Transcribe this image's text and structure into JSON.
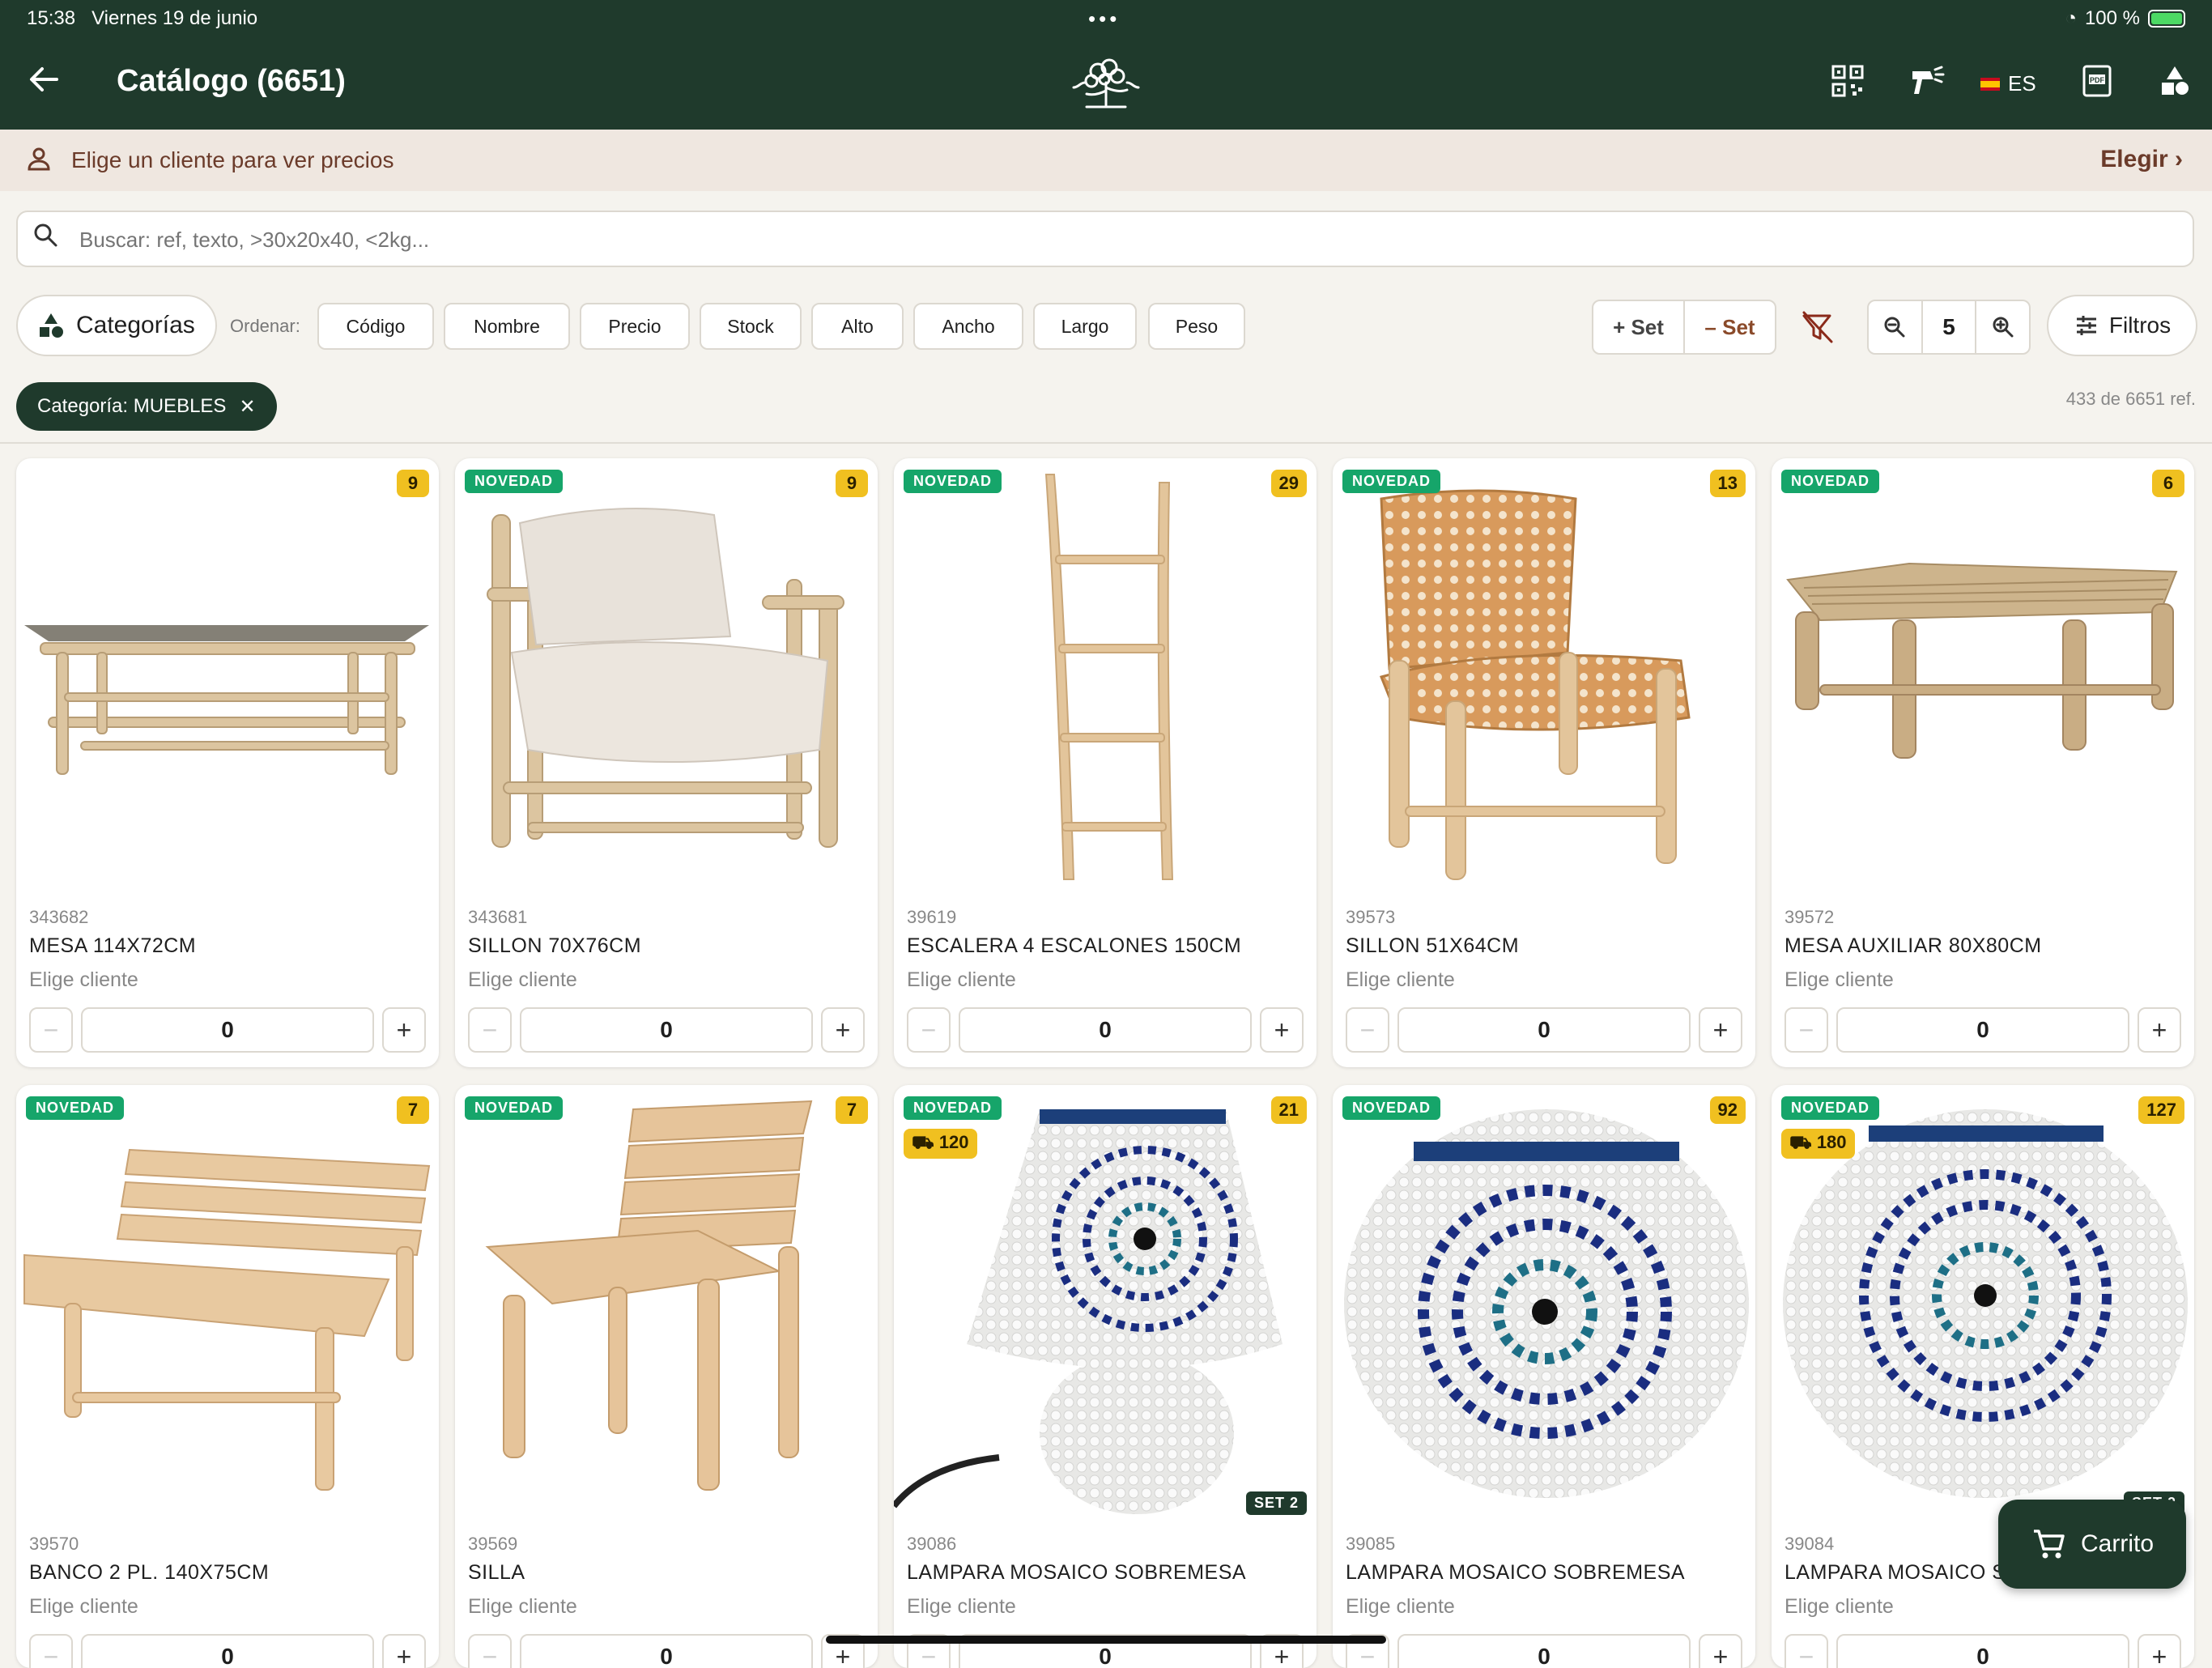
{
  "status": {
    "time": "15:38",
    "date": "Viernes 19 de junio",
    "battery": "100 %",
    "battery_level": 1.0
  },
  "header": {
    "back_icon": "arrow-left-icon",
    "title": "Catálogo (6651)",
    "language": "ES"
  },
  "client_bar": {
    "message": "Elige un cliente para ver precios",
    "action": "Elegir ›"
  },
  "search": {
    "placeholder": "Buscar: ref, texto, >30x20x40, <2kg..."
  },
  "toolbar": {
    "categories_label": "Categorías",
    "sort_label": "Ordenar:",
    "sort_options": [
      "Código",
      "Nombre",
      "Precio",
      "Stock",
      "Alto",
      "Ancho",
      "Largo",
      "Peso"
    ],
    "add_set": "+ Set",
    "remove_set": "– Set",
    "zoom_value": "5",
    "filters_label": "Filtros"
  },
  "filter_chip": {
    "label": "Categoría: MUEBLES",
    "close": "✕"
  },
  "results_count": "433 de 6651 ref.",
  "colors": {
    "brand": "#1f3a2c",
    "accent_new": "#16a56a",
    "stock_badge": "#f0c020",
    "client_text": "#6b3b2a"
  },
  "products": [
    {
      "ref": "343682",
      "name": "MESA 114X72CM",
      "price": "Elige cliente",
      "qty": "0",
      "stock": "9",
      "new": "",
      "truck": "",
      "set": ""
    },
    {
      "ref": "343681",
      "name": "SILLON 70X76CM",
      "price": "Elige cliente",
      "qty": "0",
      "stock": "9",
      "new": "NOVEDAD",
      "truck": "",
      "set": ""
    },
    {
      "ref": "39619",
      "name": "ESCALERA 4 ESCALONES 150CM",
      "price": "Elige cliente",
      "qty": "0",
      "stock": "29",
      "new": "NOVEDAD",
      "truck": "",
      "set": ""
    },
    {
      "ref": "39573",
      "name": "SILLON 51X64CM",
      "price": "Elige cliente",
      "qty": "0",
      "stock": "13",
      "new": "NOVEDAD",
      "truck": "",
      "set": ""
    },
    {
      "ref": "39572",
      "name": "MESA AUXILIAR 80X80CM",
      "price": "Elige cliente",
      "qty": "0",
      "stock": "6",
      "new": "NOVEDAD",
      "truck": "",
      "set": ""
    },
    {
      "ref": "39570",
      "name": "BANCO 2 PL. 140X75CM",
      "price": "Elige cliente",
      "qty": "0",
      "stock": "7",
      "new": "NOVEDAD",
      "truck": "",
      "set": ""
    },
    {
      "ref": "39569",
      "name": "SILLA",
      "price": "Elige cliente",
      "qty": "0",
      "stock": "7",
      "new": "NOVEDAD",
      "truck": "",
      "set": ""
    },
    {
      "ref": "39086",
      "name": "LAMPARA MOSAICO SOBREMESA",
      "price": "Elige cliente",
      "qty": "0",
      "stock": "21",
      "new": "NOVEDAD",
      "truck": "120",
      "set": "SET 2"
    },
    {
      "ref": "39085",
      "name": "LAMPARA MOSAICO SOBREMESA",
      "price": "Elige cliente",
      "qty": "0",
      "stock": "92",
      "new": "NOVEDAD",
      "truck": "",
      "set": ""
    },
    {
      "ref": "39084",
      "name": "LAMPARA MOSAICO S",
      "price": "Elige cliente",
      "qty": "0",
      "stock": "127",
      "new": "NOVEDAD",
      "truck": "180",
      "set": "SET 2"
    }
  ],
  "cart": {
    "label": "Carrito"
  }
}
